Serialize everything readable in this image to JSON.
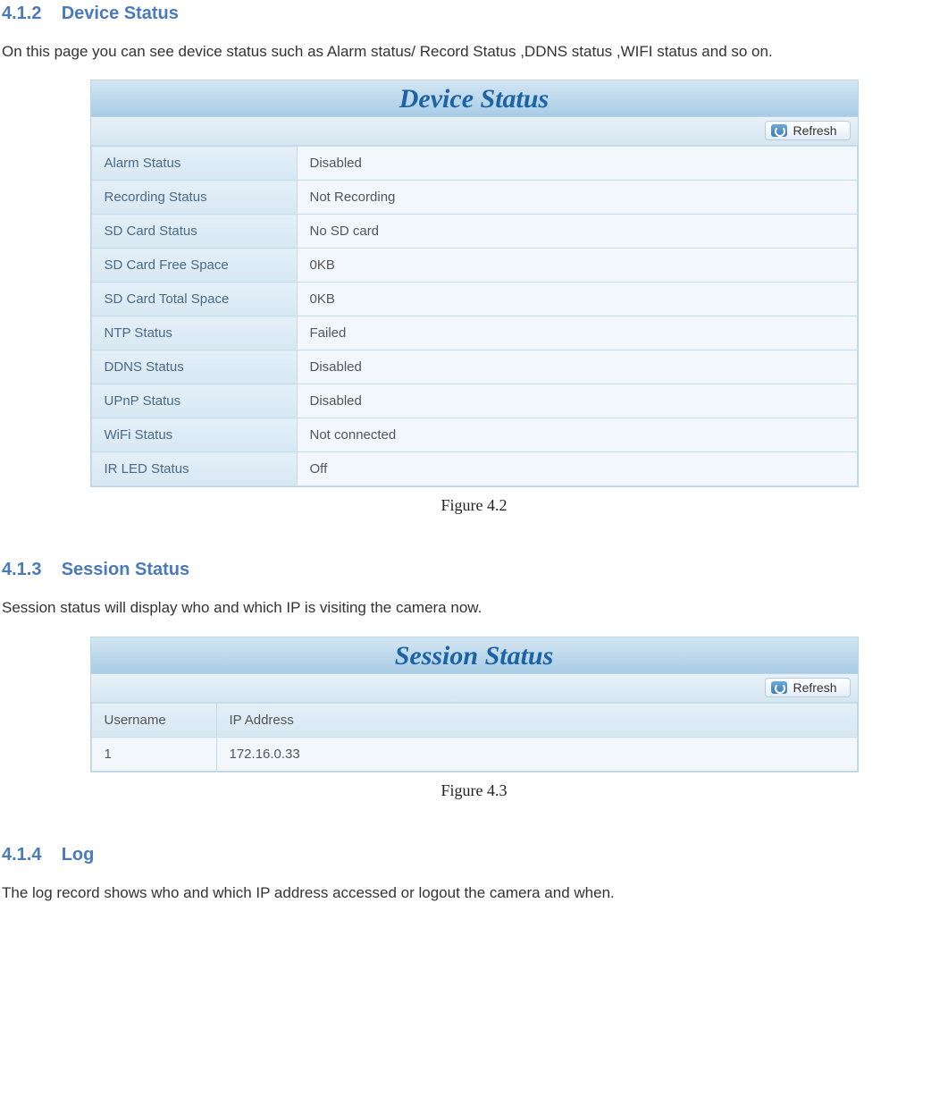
{
  "sections": {
    "s412": {
      "number": "4.1.2",
      "title": "Device Status",
      "intro": "On this page you can see device status such as Alarm status/ Record Status ,DDNS status ,WIFI status and so on.",
      "caption": "Figure 4.2"
    },
    "s413": {
      "number": "4.1.3",
      "title": "Session Status",
      "intro": "Session status will display who and which IP is visiting the camera now.",
      "caption": "Figure 4.3"
    },
    "s414": {
      "number": "4.1.4",
      "title": "Log",
      "intro": "The log record shows who and which IP address accessed or logout the camera and when."
    }
  },
  "device_panel": {
    "title": "Device Status",
    "refresh_label": "Refresh",
    "rows": [
      {
        "label": "Alarm Status",
        "value": "Disabled"
      },
      {
        "label": "Recording Status",
        "value": "Not Recording"
      },
      {
        "label": "SD Card Status",
        "value": "No SD card"
      },
      {
        "label": "SD Card Free Space",
        "value": "0KB"
      },
      {
        "label": "SD Card Total Space",
        "value": "0KB"
      },
      {
        "label": "NTP Status",
        "value": "Failed"
      },
      {
        "label": "DDNS Status",
        "value": "Disabled"
      },
      {
        "label": "UPnP Status",
        "value": "Disabled"
      },
      {
        "label": "WiFi Status",
        "value": "Not connected"
      },
      {
        "label": "IR LED Status",
        "value": "Off"
      }
    ]
  },
  "session_panel": {
    "title": "Session Status",
    "refresh_label": "Refresh",
    "headers": {
      "username": "Username",
      "ip": "IP Address"
    },
    "rows": [
      {
        "username": "1",
        "ip": "172.16.0.33"
      }
    ]
  }
}
